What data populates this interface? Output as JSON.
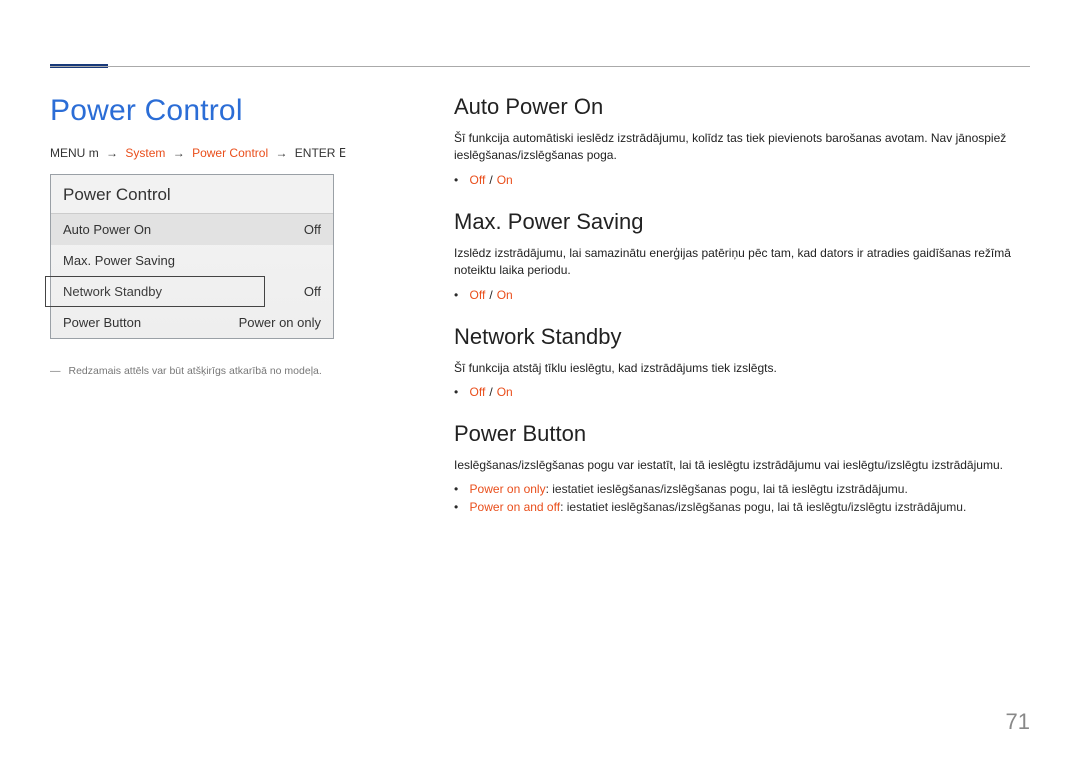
{
  "page_title": "Power Control",
  "breadcrumb": {
    "menu": "MENU",
    "menu_sym": "m",
    "path1": "System",
    "path2": "Power Control",
    "enter": "ENTER",
    "enter_sym": "E"
  },
  "panel": {
    "header": "Power Control",
    "rows": [
      {
        "label": "Auto Power On",
        "value": "Off"
      },
      {
        "label": "Max. Power Saving",
        "value": ""
      },
      {
        "label": "Network Standby",
        "value": "Off"
      },
      {
        "label": "Power Button",
        "value": "Power on only"
      }
    ]
  },
  "footnote": "Redzamais attēls var būt atšķirīgs atkarībā no modeļa.",
  "sections": {
    "auto_power_on": {
      "heading": "Auto Power On",
      "desc": "Šī funkcija automātiski ieslēdz izstrādājumu, kolīdz tas tiek pievienots barošanas avotam. Nav jānospiež ieslēgšanas/izslēgšanas poga.",
      "opt_off": "Off",
      "opt_on": "On"
    },
    "max_power_saving": {
      "heading": "Max. Power Saving",
      "desc": "Izslēdz izstrādājumu, lai samazinātu enerģijas patēriņu pēc tam, kad dators ir atradies gaidīšanas režīmā noteiktu laika periodu.",
      "opt_off": "Off",
      "opt_on": "On"
    },
    "network_standby": {
      "heading": "Network Standby",
      "desc": "Šī funkcija atstāj tīklu ieslēgtu, kad izstrādājums tiek izslēgts.",
      "opt_off": "Off",
      "opt_on": "On"
    },
    "power_button": {
      "heading": "Power Button",
      "desc": "Ieslēgšanas/izslēgšanas pogu var iestatīt, lai tā ieslēgtu izstrādājumu vai ieslēgtu/izslēgtu izstrādājumu.",
      "item1_key": "Power on only",
      "item1_rest": ": iestatiet ieslēgšanas/izslēgšanas pogu, lai tā ieslēgtu izstrādājumu.",
      "item2_key": "Power on and off",
      "item2_rest": ": iestatiet ieslēgšanas/izslēgšanas pogu, lai tā ieslēgtu/izslēgtu izstrādājumu."
    }
  },
  "page_number": "71"
}
